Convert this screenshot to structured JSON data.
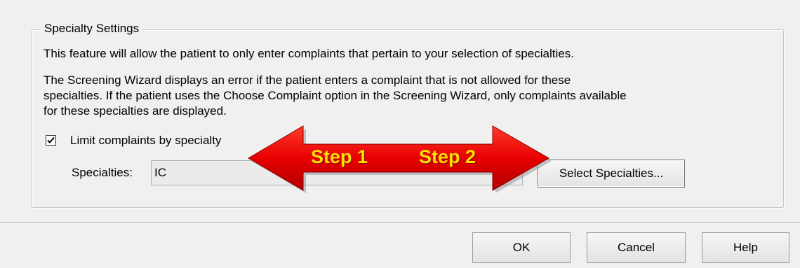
{
  "specialty_settings": {
    "group_title": "Specialty Settings",
    "description_1": "This feature will allow the patient to only enter complaints that pertain to your selection of specialties.",
    "description_2_lines": [
      "The Screening Wizard displays an error if the patient enters a complaint that is not allowed for these",
      "specialties. If the patient uses the Choose Complaint option in the Screening Wizard, only complaints available",
      "for these specialties are displayed."
    ],
    "limit_checkbox": {
      "label": "Limit complaints by specialty",
      "checked": true
    },
    "specialties_label": "Specialties:",
    "specialties_value": "IC",
    "select_button_label": "Select Specialties..."
  },
  "annotation": {
    "step1": "Step 1",
    "step2": "Step 2",
    "arrow_color": "#e80000",
    "text_color": "#ffe000"
  },
  "footer": {
    "ok_label": "OK",
    "cancel_label": "Cancel",
    "help_label": "Help"
  }
}
